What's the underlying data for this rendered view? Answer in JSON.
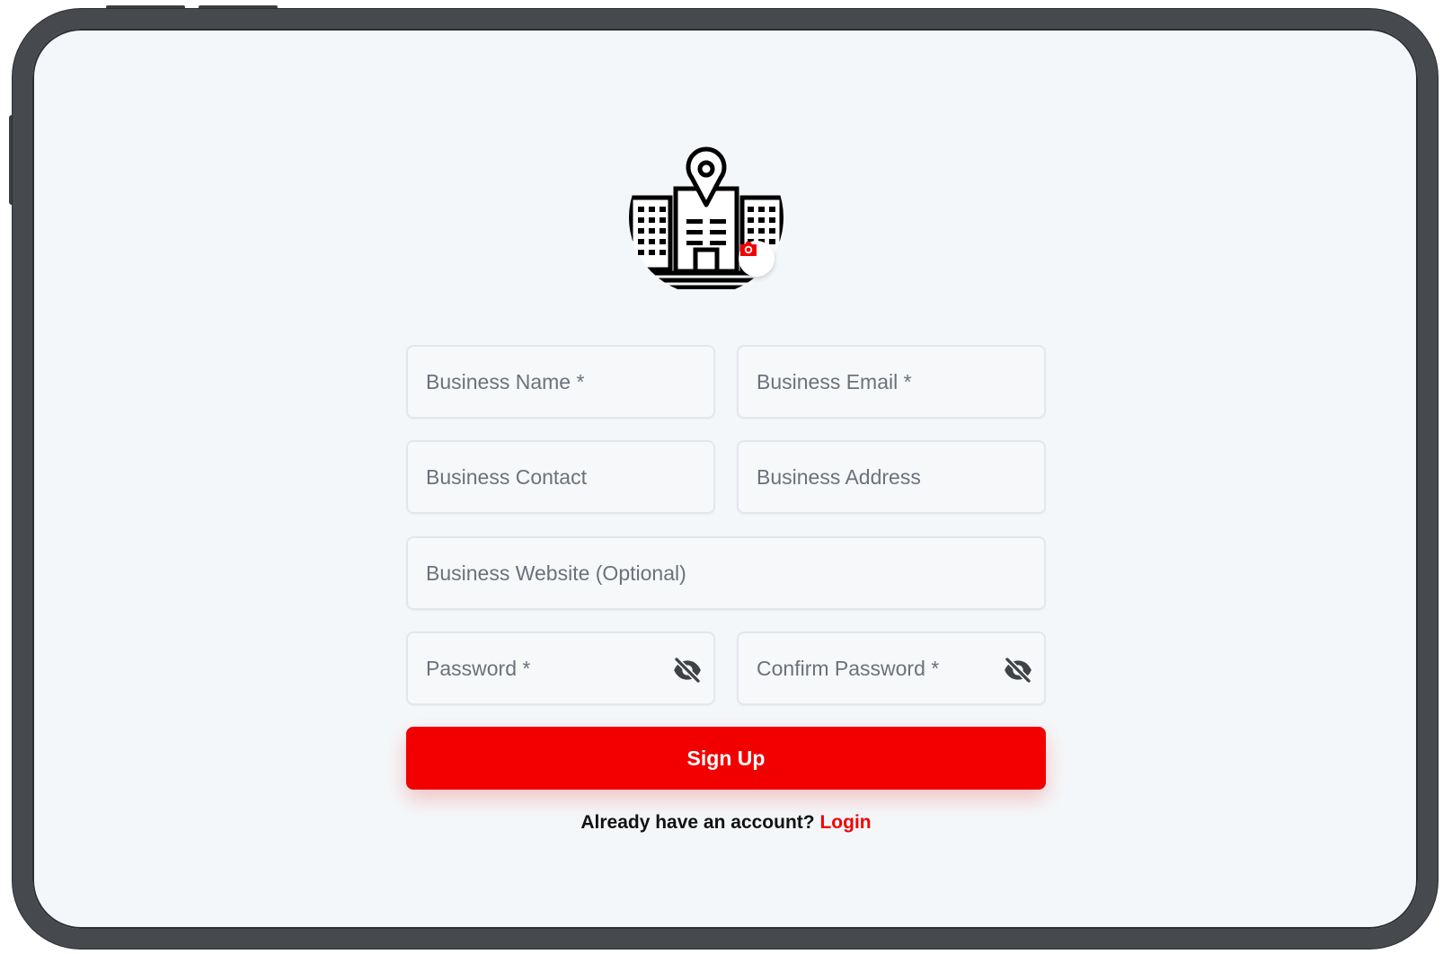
{
  "form": {
    "business_name_placeholder": "Business Name *",
    "business_email_placeholder": "Business Email *",
    "business_contact_placeholder": "Business Contact",
    "business_address_placeholder": "Business Address",
    "business_website_placeholder": "Business Website (Optional)",
    "password_placeholder": "Password *",
    "confirm_password_placeholder": "Confirm Password *"
  },
  "actions": {
    "signup_label": "Sign Up",
    "login_prompt": "Already have an account?",
    "login_link": "Login"
  },
  "icons": {
    "logo": "building-location-icon",
    "badge": "camera-icon",
    "password_toggle": "eye-off-icon"
  },
  "colors": {
    "accent": "#f20000",
    "screen_background": "#f4f7f9",
    "device_frame": "#46494e"
  }
}
